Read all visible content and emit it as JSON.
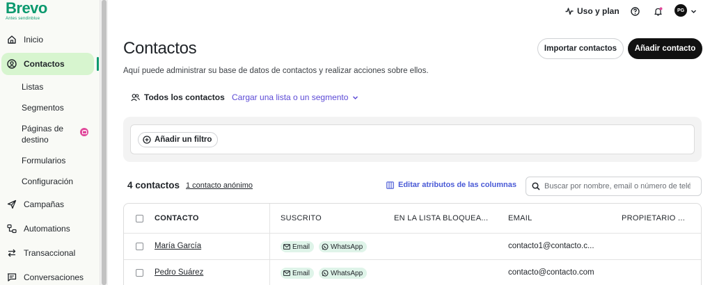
{
  "brand": {
    "name": "Brevo",
    "sub": "Antes sendinblue",
    "color": "#0b996e"
  },
  "sidebar": {
    "items": [
      {
        "label": "Inicio",
        "icon": "home-icon"
      },
      {
        "label": "Contactos",
        "icon": "contact-circle-icon",
        "active": true
      },
      {
        "label": "Campañas",
        "icon": "send-icon"
      },
      {
        "label": "Automations",
        "icon": "automation-icon"
      },
      {
        "label": "Transaccional",
        "icon": "transfer-icon"
      },
      {
        "label": "Conversaciones",
        "icon": "chat-icon"
      }
    ],
    "subitems": [
      "Listas",
      "Segmentos",
      "Páginas de destino",
      "Formularios",
      "Configuración"
    ],
    "subitem_landing_line1": "Páginas de",
    "subitem_landing_line2": "destino"
  },
  "topbar": {
    "usage_label": "Uso y plan",
    "avatar_initials": "PG"
  },
  "page": {
    "title": "Contactos",
    "description": "Aquí puede administrar su base de datos de contactos y realizar acciones sobre ellos.",
    "import_button": "Importar contactos",
    "add_button": "Añadir contacto"
  },
  "segments": {
    "all_label": "Todos los contactos",
    "load_label": "Cargar una lista o un segmento"
  },
  "filter": {
    "add_label": "Añadir un filtro"
  },
  "summary": {
    "count_label": "4 contactos",
    "anon_link": "1 contacto anónimo",
    "edit_columns": "Editar atributos de las columnas",
    "search_placeholder": "Buscar por nombre, email o número de teléfono"
  },
  "table": {
    "columns": [
      "CONTACTO",
      "SUSCRITO",
      "EN LA LISTA BLOQUEA...",
      "EMAIL",
      "PROPIETARIO ..."
    ],
    "rows": [
      {
        "name": "María García",
        "subscribed": [
          "Email",
          "WhatsApp"
        ],
        "email": "contacto1@contacto.c..."
      },
      {
        "name": "Pedro Suárez",
        "subscribed": [
          "Email",
          "WhatsApp"
        ],
        "email": "contacto@contacto.com"
      }
    ]
  },
  "colors": {
    "accent_green": "#0b996e",
    "active_bg": "#d7f5cf",
    "link_purple": "#5c4ad6",
    "chip_bg": "#dff4e9"
  }
}
